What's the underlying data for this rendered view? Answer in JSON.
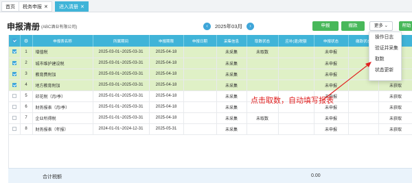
{
  "tabs": [
    {
      "label": "首页",
      "closable": false,
      "active": false
    },
    {
      "label": "税务申报",
      "closable": true,
      "active": false
    },
    {
      "label": "进入清册",
      "closable": true,
      "active": true
    }
  ],
  "header": {
    "title": "申报清册",
    "subtitle": "(ABC酒业有限公司)",
    "period": "2025年03月",
    "prev_icon": "chevron-left-icon",
    "next_icon": "chevron-right-icon"
  },
  "toolbar": {
    "declare_label": "申报",
    "withdraw_label": "撤款",
    "more_label": "更多",
    "help_label": "帮助",
    "accent_color": "#48b85a"
  },
  "more_menu": {
    "items": [
      "操作日志",
      "验证并采集",
      "取数",
      "状态更新"
    ]
  },
  "table": {
    "columns": [
      "申报表名称",
      "所属期间",
      "申报期限",
      "申报日期",
      "采集信息",
      "取数状态",
      "应补(退)税额",
      "申报状态",
      "缴款状态",
      "操作"
    ],
    "header_color": "#40b4d8",
    "rows": [
      {
        "checked": true,
        "no": "1",
        "name": "增值税",
        "period": "2025-03-01~2025-03-31",
        "deadline": "2025-04-18",
        "date": "",
        "collect": "未采集",
        "fetch": "未取数",
        "tax": "",
        "declare": "未申报",
        "pay": "",
        "op": ""
      },
      {
        "checked": true,
        "no": "2",
        "name": "城市维护建设税",
        "period": "2025-03-01~2025-03-31",
        "deadline": "2025-04-18",
        "date": "",
        "collect": "未采集",
        "fetch": "",
        "tax": "",
        "declare": "未申报",
        "pay": "",
        "op": ""
      },
      {
        "checked": true,
        "no": "3",
        "name": "教育费附加",
        "period": "2025-03-01~2025-03-31",
        "deadline": "2025-04-18",
        "date": "",
        "collect": "未采集",
        "fetch": "",
        "tax": "",
        "declare": "未申报",
        "pay": "",
        "op": "未获取"
      },
      {
        "checked": true,
        "no": "4",
        "name": "地方教育附加",
        "period": "2025-03-01~2025-03-31",
        "deadline": "2025-04-18",
        "date": "",
        "collect": "未采集",
        "fetch": "",
        "tax": "",
        "declare": "未申报",
        "pay": "",
        "op": "未获取"
      },
      {
        "checked": false,
        "no": "5",
        "name": "印花税（月/季）",
        "period": "2025-01-01~2025-03-31",
        "deadline": "2025-04-18",
        "date": "",
        "collect": "未采集",
        "fetch": "",
        "tax": "",
        "declare": "未申报",
        "pay": "",
        "op": "未获取"
      },
      {
        "checked": false,
        "no": "6",
        "name": "财务报表（月/季）",
        "period": "2025-01-01~2025-03-31",
        "deadline": "2025-04-18",
        "date": "",
        "collect": "未采集",
        "fetch": "",
        "tax": "",
        "declare": "未申报",
        "pay": "",
        "op": "未获取"
      },
      {
        "checked": false,
        "no": "7",
        "name": "企业所得税",
        "period": "2025-01-01~2025-03-31",
        "deadline": "2025-04-18",
        "date": "",
        "collect": "未采集",
        "fetch": "未取数",
        "tax": "",
        "declare": "未申报",
        "pay": "",
        "op": "未获取"
      },
      {
        "checked": false,
        "no": "8",
        "name": "财务报表（年报）",
        "period": "2024-01-01~2024-12-31",
        "deadline": "2025-05-31",
        "date": "",
        "collect": "未采集",
        "fetch": "",
        "tax": "",
        "declare": "未申报",
        "pay": "",
        "op": "未获取"
      }
    ]
  },
  "footer": {
    "total_label": "合计税额",
    "total_value": "0.00"
  },
  "annotation": {
    "text": "点击取数，自动填写报表",
    "color": "#e02020"
  }
}
